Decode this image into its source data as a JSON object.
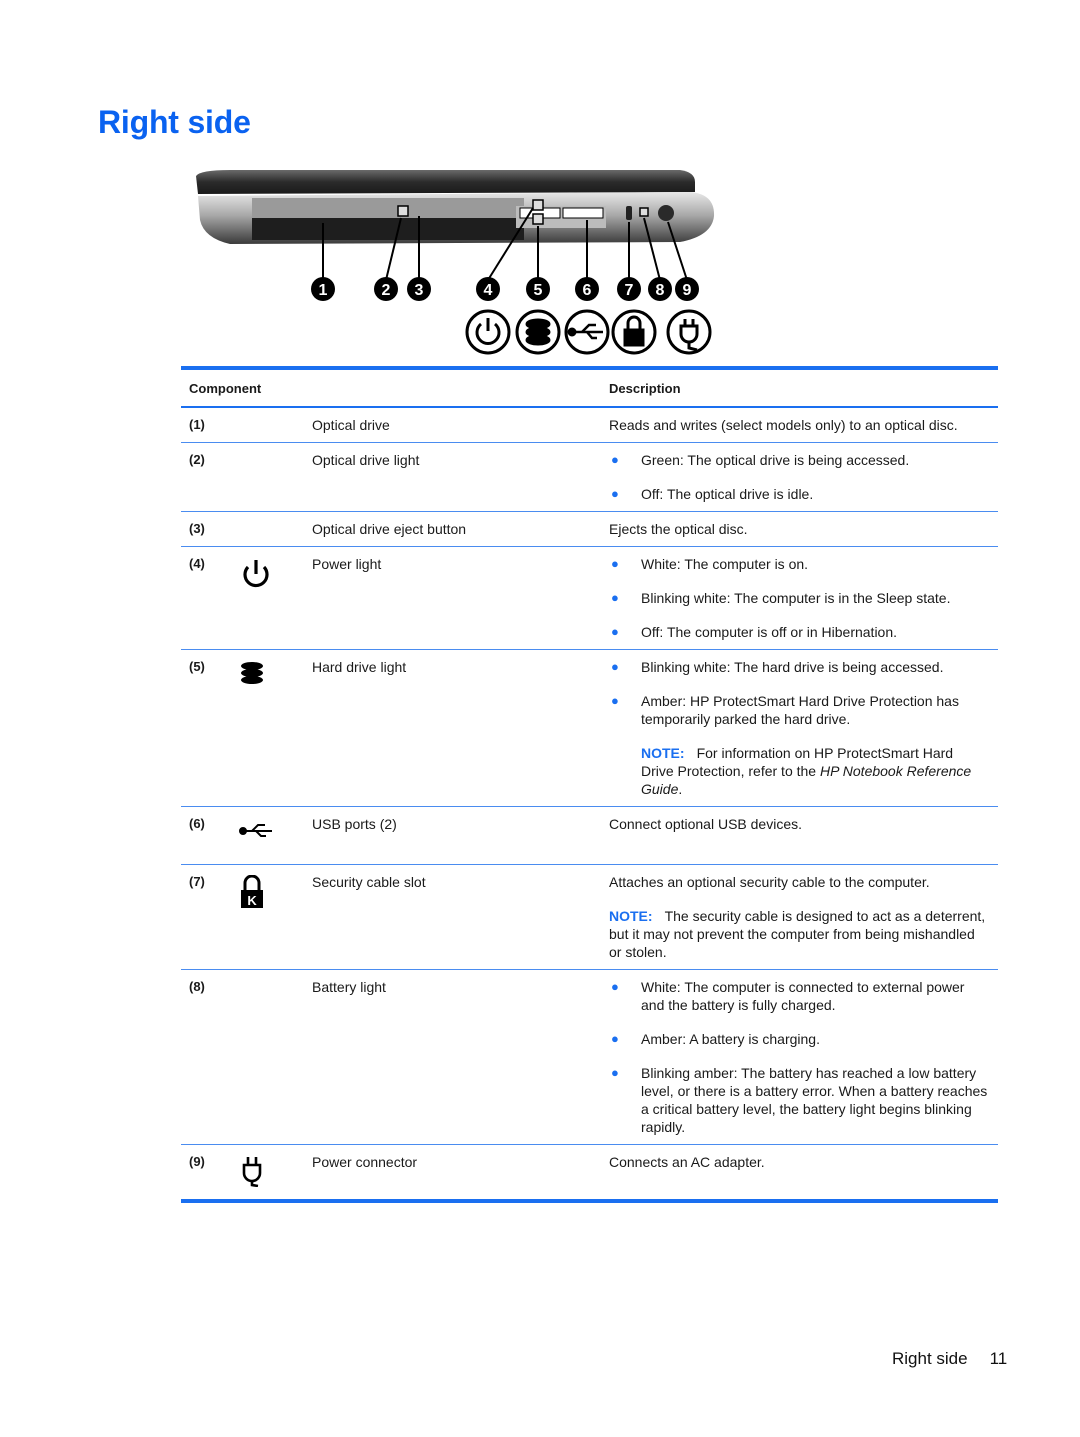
{
  "page": {
    "title": "Right side",
    "footer_section": "Right side",
    "footer_page": "11"
  },
  "figure": {
    "callouts": [
      "1",
      "2",
      "3",
      "4",
      "5",
      "6",
      "7",
      "8",
      "9"
    ],
    "icons": [
      "power-icon",
      "hard-drive-icon",
      "usb-icon",
      "security-lock-icon",
      "power-plug-icon"
    ]
  },
  "table": {
    "headers": {
      "component": "Component",
      "description": "Description"
    },
    "accent_color": "#1a6ff0",
    "rows": [
      {
        "num": "(1)",
        "icon": "",
        "name": "Optical drive",
        "description": "Reads and writes (select models only) to an optical disc."
      },
      {
        "num": "(2)",
        "icon": "",
        "name": "Optical drive light",
        "bullets": [
          "Green: The optical drive is being accessed.",
          "Off: The optical drive is idle."
        ]
      },
      {
        "num": "(3)",
        "icon": "",
        "name": "Optical drive eject button",
        "description": "Ejects the optical disc."
      },
      {
        "num": "(4)",
        "icon": "power-icon",
        "name": "Power light",
        "bullets": [
          "White: The computer is on.",
          "Blinking white: The computer is in the Sleep state.",
          "Off: The computer is off or in Hibernation."
        ]
      },
      {
        "num": "(5)",
        "icon": "hard-drive-icon",
        "name": "Hard drive light",
        "bullets": [
          "Blinking white: The hard drive is being accessed.",
          "Amber: HP ProtectSmart Hard Drive Protection has temporarily parked the hard drive."
        ],
        "note": {
          "label": "NOTE:",
          "text_before": "For information on HP ProtectSmart Hard Drive Protection, refer to the ",
          "italic": "HP Notebook Reference Guide",
          "text_after": "."
        }
      },
      {
        "num": "(6)",
        "icon": "usb-icon",
        "name": "USB ports (2)",
        "description": "Connect optional USB devices."
      },
      {
        "num": "(7)",
        "icon": "security-lock-icon",
        "name": "Security cable slot",
        "description": "Attaches an optional security cable to the computer.",
        "note": {
          "label": "NOTE:",
          "text": "The security cable is designed to act as a deterrent, but it may not prevent the computer from being mishandled or stolen."
        }
      },
      {
        "num": "(8)",
        "icon": "",
        "name": "Battery light",
        "bullets": [
          "White: The computer is connected to external power and the battery is fully charged.",
          "Amber: A battery is charging.",
          "Blinking amber: The battery has reached a low battery level, or there is a battery error. When a battery reaches a critical battery level, the battery light begins blinking rapidly."
        ]
      },
      {
        "num": "(9)",
        "icon": "power-plug-icon",
        "name": "Power connector",
        "description": "Connects an AC adapter."
      }
    ]
  }
}
